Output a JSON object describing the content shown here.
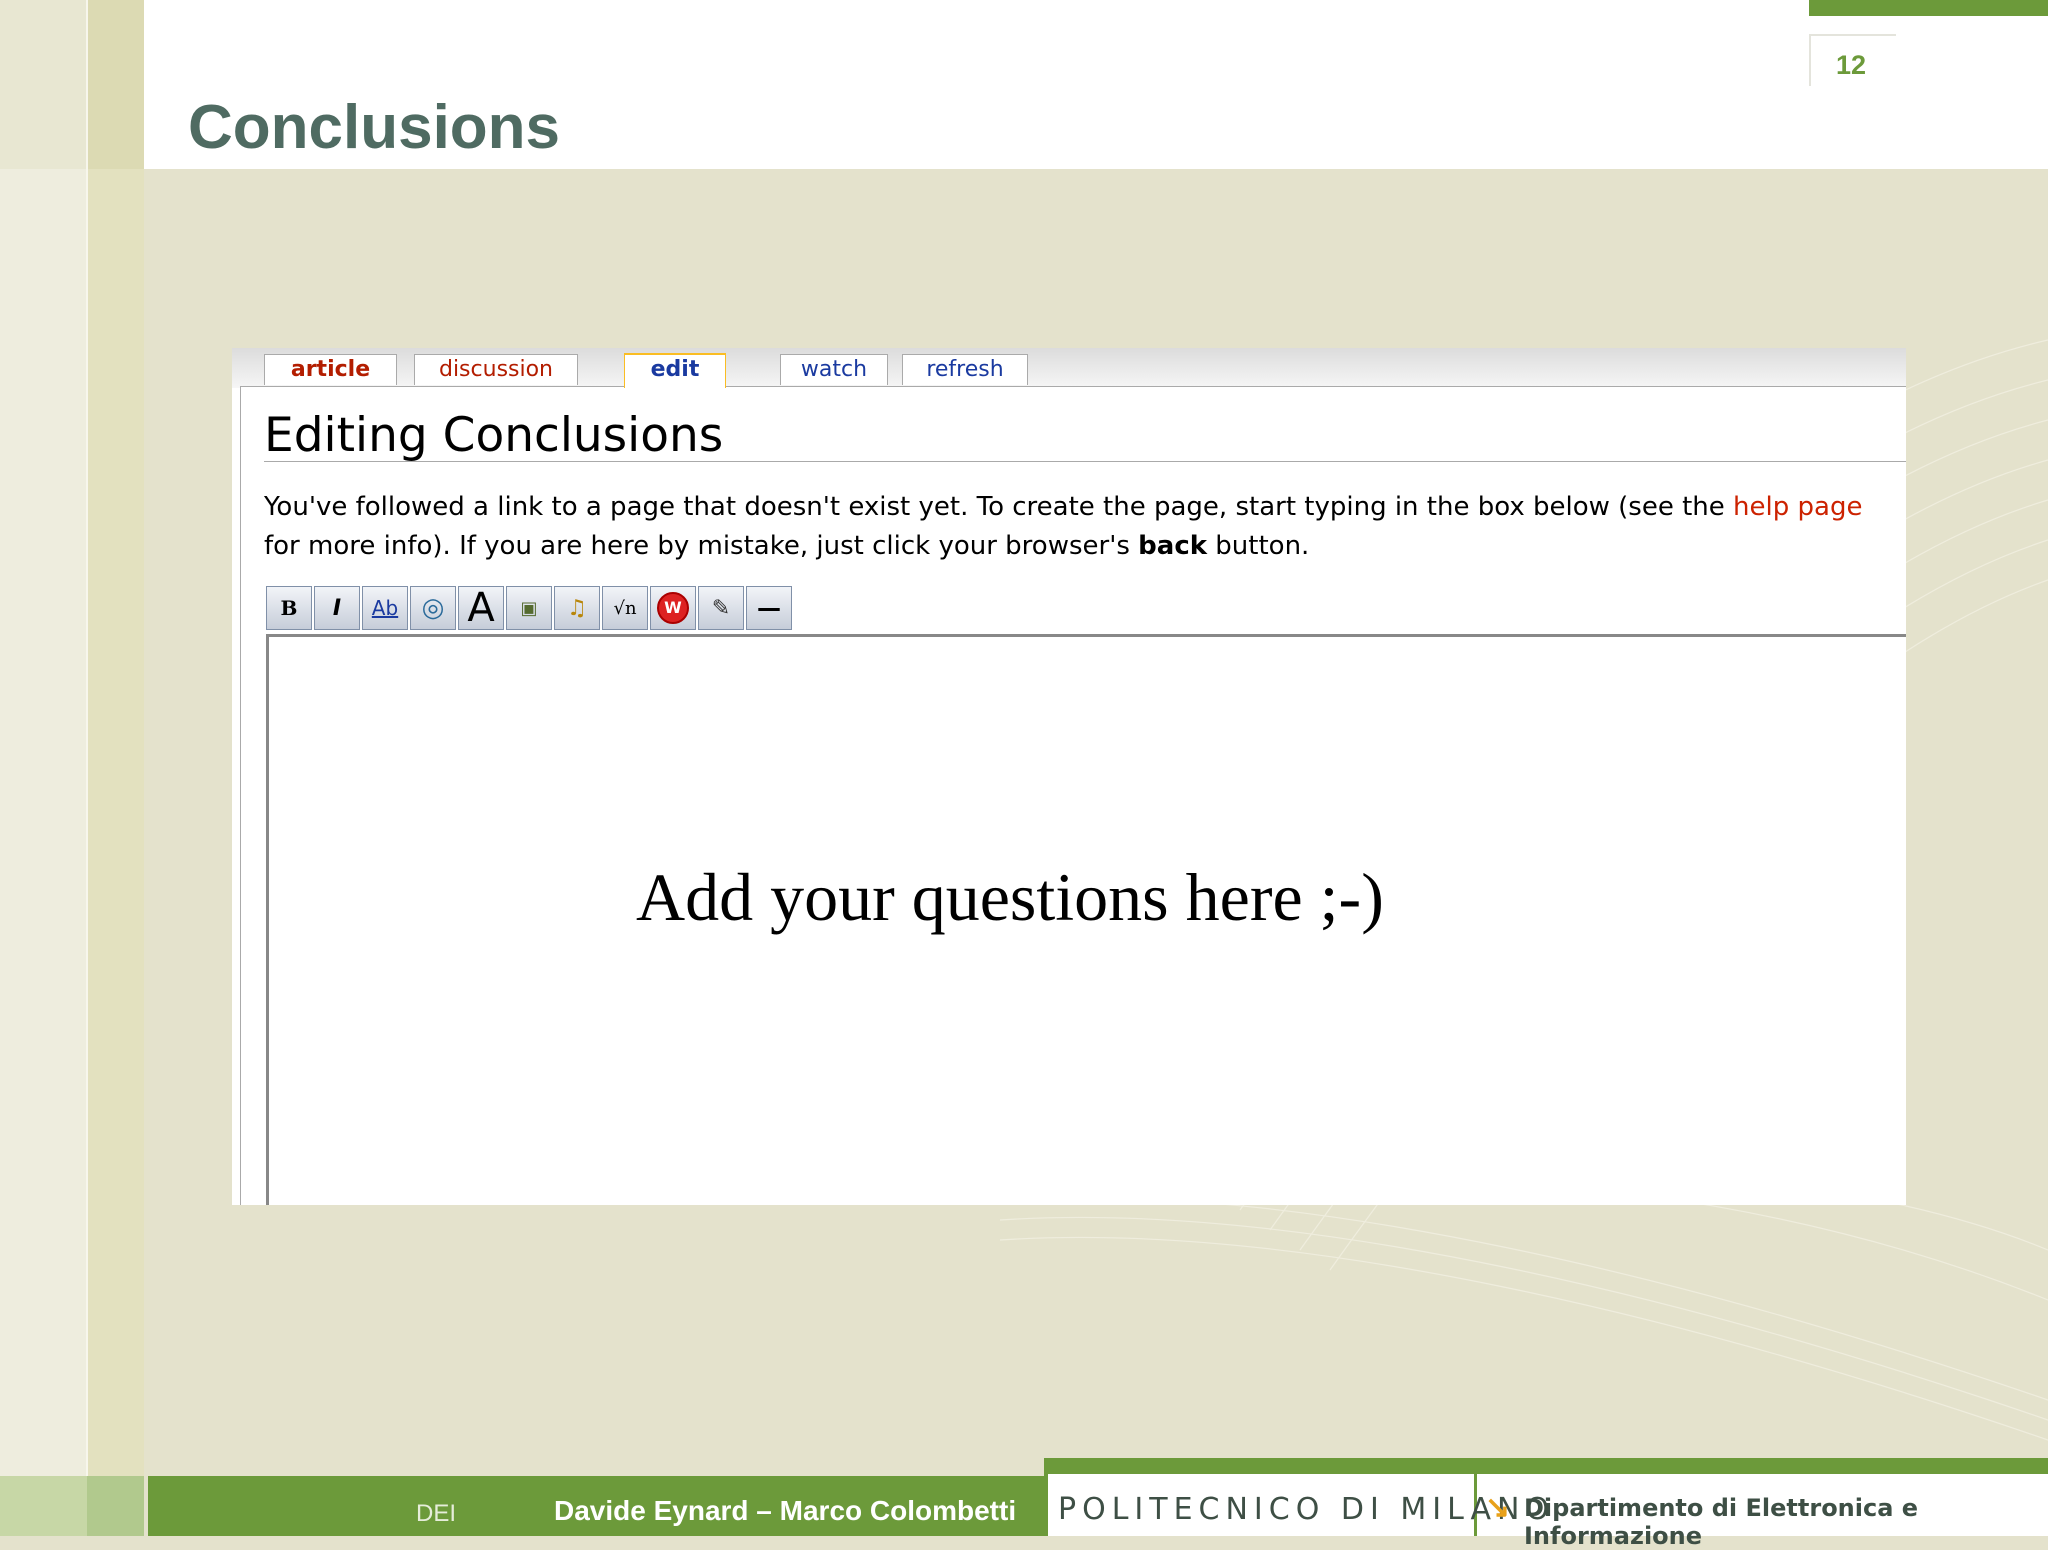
{
  "slide": {
    "page_number": "12",
    "title": "Conclusions"
  },
  "wiki": {
    "tabs": [
      {
        "label": "article",
        "color": "#b31d00"
      },
      {
        "label": "discussion",
        "color": "#b31d00"
      },
      {
        "label": "edit",
        "color": "#1a3aa0"
      },
      {
        "label": "watch",
        "color": "#1a3aa0"
      },
      {
        "label": "refresh",
        "color": "#1a3aa0"
      }
    ],
    "heading": "Editing Conclusions",
    "notice_part1": "You've followed a link to a page that doesn't exist yet. To create the page, start typing in the box below (see the ",
    "notice_link": "help page",
    "notice_part2": " for more info). If you are here by mistake, just click your browser's ",
    "notice_bold": "back",
    "notice_part3": " button.",
    "toolbar_icons": [
      "bold-icon",
      "italic-icon",
      "internal-link-icon",
      "external-link-icon",
      "headline-icon",
      "image-icon",
      "media-icon",
      "math-icon",
      "nowiki-icon",
      "signature-icon",
      "horizontal-line-icon"
    ],
    "toolbar_glyphs": [
      "B",
      "I",
      "Ab",
      "◎",
      "A",
      "▣",
      "♫",
      "√n",
      "W",
      "✎",
      "—"
    ]
  },
  "overlay_text": "Add your questions here ;-)",
  "footer": {
    "dei": "DEI",
    "authors": "Davide Eynard – Marco Colombetti",
    "institution": "POLITECNICO DI MILANO",
    "department": "Dipartimento di Elettronica e Informazione"
  },
  "colors": {
    "accent_green": "#6c9a3a",
    "title": "#4f6b62"
  }
}
